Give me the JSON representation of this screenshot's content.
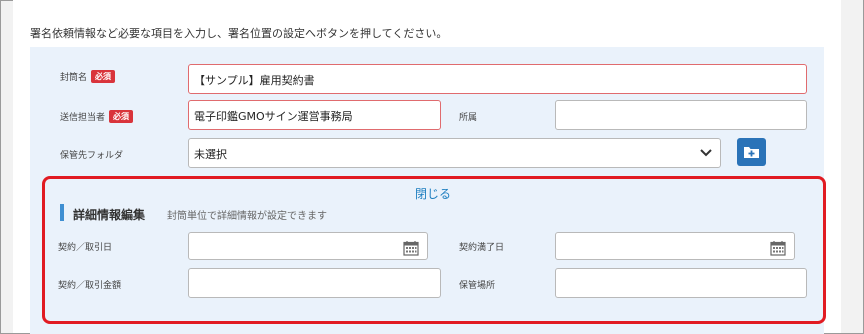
{
  "instruction": "署名依頼情報など必要な項目を入力し、署名位置の設定へボタンを押してください。",
  "required_badge": "必須",
  "fields": {
    "envelope_name": {
      "label": "封筒名",
      "value": "【サンプル】雇用契約書"
    },
    "sender": {
      "label": "送信担当者",
      "value": "電子印鑑GMOサイン運営事務局"
    },
    "department": {
      "label": "所属",
      "value": ""
    },
    "storage_folder": {
      "label": "保管先フォルダ",
      "value": "未選択"
    }
  },
  "detail": {
    "close_label": "閉じる",
    "title": "詳細情報編集",
    "description": "封筒単位で詳細情報が設定できます",
    "contract_date": {
      "label": "契約／取引日",
      "value": ""
    },
    "expiry_date": {
      "label": "契約満了日",
      "value": ""
    },
    "amount": {
      "label": "契約／取引金額",
      "value": ""
    },
    "storage_location": {
      "label": "保管場所",
      "value": ""
    }
  },
  "icons": {
    "folder_add": "folder-plus-icon",
    "calendar": "calendar-icon",
    "dropdown": "chevron-down-icon"
  },
  "colors": {
    "panel_bg": "#eaf2fb",
    "required_red": "#d9343b",
    "highlight_red": "#e11b22",
    "accent_blue": "#2a73b8",
    "link_blue": "#1e7fc0"
  }
}
